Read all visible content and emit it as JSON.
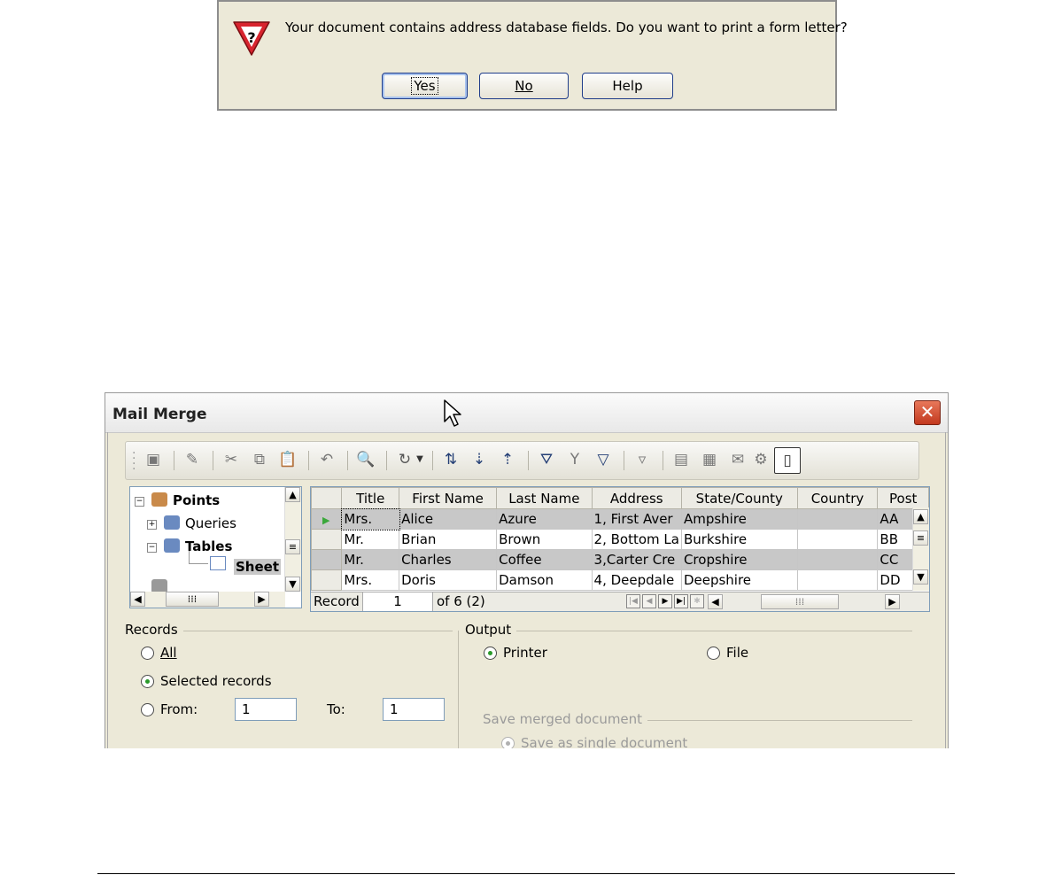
{
  "confirm_dialog": {
    "message": "Your document contains address database fields. Do you want to print a form letter?",
    "icon": "warning-icon",
    "buttons": {
      "yes": "Yes",
      "no": "No",
      "help": "Help"
    }
  },
  "mail_merge": {
    "title": "Mail Merge",
    "close_glyph": "✕",
    "toolbar_icons": [
      "save-icon",
      "edit-icon",
      "cut-icon",
      "copy-icon",
      "paste-icon",
      "undo-icon",
      "find-icon",
      "refresh-icon",
      "dropdown-arrow-icon",
      "sort-icon",
      "sort-ascending-icon",
      "sort-descending-icon",
      "autofilter-icon",
      "standard-filter-icon",
      "remove-filter-icon",
      "apply-filter-icon",
      "data-to-text-icon",
      "data-to-fields-icon",
      "mail-merge-icon",
      "source-icon",
      "explorer-toggle-icon"
    ],
    "tree": {
      "root": "Points",
      "queries": "Queries",
      "tables": "Tables",
      "sheet": "Sheet"
    },
    "grid": {
      "columns": [
        "Title",
        "First Name",
        "Last Name",
        "Address",
        "State/County",
        "Country",
        "Post"
      ],
      "rows": [
        [
          "Mrs.",
          "Alice",
          "Azure",
          "1, First Aver",
          "Ampshire",
          "",
          "AA"
        ],
        [
          "Mr.",
          "Brian",
          "Brown",
          "2, Bottom La",
          "Burkshire",
          "",
          "BB"
        ],
        [
          "Mr.",
          "Charles",
          "Coffee",
          "3,Carter Cre",
          "Cropshire",
          "",
          "CC"
        ],
        [
          "Mrs.",
          "Doris",
          "Damson",
          "4, Deepdale",
          "Deepshire",
          "",
          "DD"
        ]
      ],
      "selected_rows": [
        0,
        2
      ],
      "current_row": 0,
      "record_label": "Record",
      "record_value": "1",
      "record_of": "of 6 (2)"
    },
    "records": {
      "label": "Records",
      "all": "All",
      "selected": "Selected records",
      "from_label": "From:",
      "from_value": "1",
      "to_label": "To:",
      "to_value": "1",
      "checked": "selected"
    },
    "output": {
      "label": "Output",
      "printer": "Printer",
      "file": "File",
      "checked": "printer",
      "save_merged_label": "Save merged document",
      "save_single": "Save as single document"
    }
  }
}
